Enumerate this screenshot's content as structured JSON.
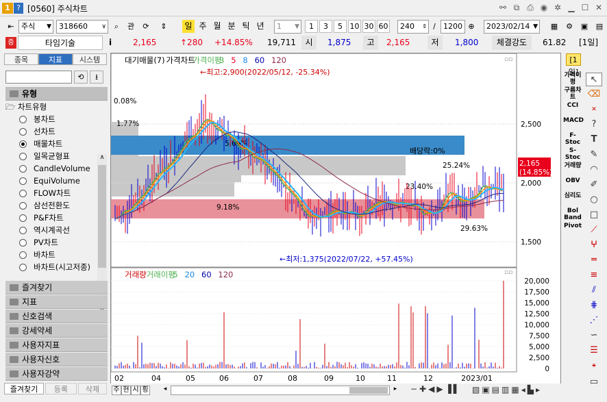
{
  "window": {
    "app_badge": "1",
    "help_badge": "?",
    "title": "[0560] 주식차트"
  },
  "toolbar": {
    "market": "주식",
    "code": "318660",
    "btn_kwan": "관",
    "periods": [
      "일",
      "주",
      "월",
      "분",
      "틱",
      "년"
    ],
    "active_period": "일",
    "interval": "1",
    "intervals": [
      "1",
      "3",
      "5",
      "10",
      "30",
      "60"
    ],
    "count": "240",
    "slash": "/",
    "total": "1200",
    "date": "2023/02/14"
  },
  "info": {
    "badge": "증",
    "name": "타임기술",
    "info_icon": "i",
    "price": "2,165",
    "change": "↑280",
    "change_pct": "+14.85%",
    "volume": "19,711",
    "open_label": "시",
    "open": "1,875",
    "high_label": "고",
    "high": "2,165",
    "low_label": "저",
    "low": "1,800",
    "strength_label": "체결강도",
    "strength": "61.82",
    "period_tag": "[1일]"
  },
  "left_panel": {
    "tabs": [
      "종목",
      "지표",
      "시스템"
    ],
    "active_tab": "지표",
    "section_type": "유형",
    "tree_root": "차트유형",
    "chart_types": [
      "봉차트",
      "선차트",
      "매물차트",
      "일목균형표",
      "CandleVolume",
      "EquiVolume",
      "FLOW차트",
      "삼선전환도",
      "P&F차트",
      "역시계곡선",
      "PV차트",
      "바차트",
      "바차트(시고저종)"
    ],
    "selected_type": "매물차트",
    "sections": [
      "즐겨찾기",
      "지표",
      "신호검색",
      "강세약세",
      "사용자지표",
      "사용자신호",
      "사용자강약"
    ],
    "bottom_tabs": [
      "즐겨찾기",
      "등록",
      "삭제"
    ]
  },
  "chart": {
    "price_legend": [
      "대기매물(7)",
      "가격차트",
      "가격이평",
      "3",
      "5",
      "8",
      "60",
      "120"
    ],
    "volume_legend": [
      "거래량",
      "거래이평",
      "5",
      "20",
      "60",
      "120"
    ],
    "high_annotation": "←최고:2,900(2022/05/12, -25.34%)",
    "low_annotation": "←최저:1,375(2022/07/22, +57.45%)",
    "dividend": "배당락:0%",
    "pct_labels": [
      "0.08%",
      "1.77%",
      "5.69%",
      "9.18%",
      "25.24%",
      "23.40%",
      "29.63%"
    ],
    "current_price_tag": "2,165",
    "current_pct_tag": "(14.85%)",
    "price_axis": [
      "2,500",
      "2,000",
      "1,500"
    ],
    "volume_axis": [
      "20,000",
      "17,500",
      "15,000",
      "12,500",
      "10,000",
      "7,500",
      "5,000",
      "2,500",
      "0"
    ],
    "x_axis": [
      "02",
      "04",
      "05",
      "06",
      "07",
      "08",
      "09",
      "10",
      "11",
      "12",
      "2023/01"
    ],
    "colors": {
      "bar_gray": "#c8c8c8",
      "bar_blue": "#3a8bc9",
      "bar_pink": "#e8919a",
      "up": "#e8001c",
      "down": "#0000cc"
    }
  },
  "right_indicators": [
    "가격이평",
    "구름차트",
    "CCI",
    "MACD",
    "F-Stoc",
    "S-Stoc",
    "거래량",
    "OBV",
    "심리도",
    "Bol Band",
    "Pivot"
  ],
  "footer": {
    "tabs": [
      "주",
      "현",
      "시",
      "횡"
    ]
  }
}
